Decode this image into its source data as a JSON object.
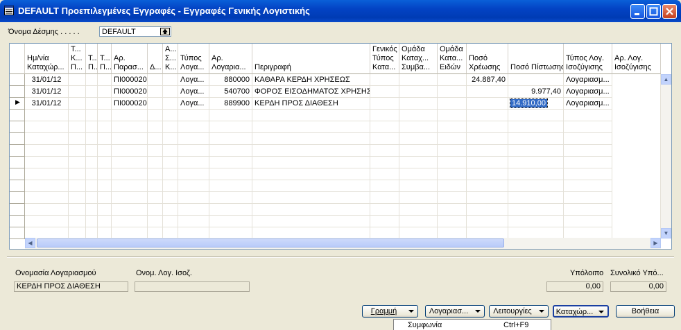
{
  "window": {
    "title": "DEFAULT Προεπιλεγμένες Εγγραφές - Εγγραφές Γενικής Λογιστικής"
  },
  "view": {
    "label": "Όνομα Δέσμης . . . . .",
    "value": "DEFAULT"
  },
  "grid": {
    "columns": [
      "Ημ/νία\nΚαταχώρ...",
      "Τ...\nΚ...\nΠ...",
      "Τ...\nΠ...",
      "Τ...\nΠ...",
      "Αρ.\nΠαρασ...",
      "Δ...",
      "Α...\nΣ...\nΚ...",
      "Τύπος\nΛογα...",
      "Αρ.\nΛογαρια...",
      "Περιγραφή",
      "Γενικός\nΤύπος\nΚατα...",
      "Ομάδα\nΚαταχ...\nΣυμβα...",
      "Ομάδα\nΚατα...\nΕιδών",
      "Ποσό\nΧρέωσης",
      "Ποσό Πίστωσης",
      "Τύπος Λογ.\nΙσοζύγισης",
      "Αρ. Λογ.\nΙσοζύγισης"
    ],
    "rows": [
      {
        "date": "31/01/12",
        "doc_no": "ΠΙ000020",
        "acc_type": "Λογα...",
        "acc_no": "880000",
        "description": "ΚΑΘΑΡΑ ΚΕΡΔΗ ΧΡΗΣΕΩΣ",
        "debit": "24.887,40",
        "credit": "",
        "bal_type": "Λογαριασμ..."
      },
      {
        "date": "31/01/12",
        "doc_no": "ΠΙ000020",
        "acc_type": "Λογα...",
        "acc_no": "540700",
        "description": "ΦΟΡΟΣ ΕΙΣΟΔΗΜΑΤΟΣ ΧΡΗΣΗΣ",
        "debit": "",
        "credit": "9.977,40",
        "bal_type": "Λογαριασμ..."
      },
      {
        "date": "31/01/12",
        "doc_no": "ΠΙ000020",
        "acc_type": "Λογα...",
        "acc_no": "889900",
        "description": "ΚΕΡΔΗ ΠΡΟΣ ΔΙΑΘΕΣΗ",
        "debit": "",
        "credit": "14.910,00",
        "bal_type": "Λογαριασμ..."
      }
    ],
    "current_row_marker": "▶"
  },
  "footer": {
    "account_name_label": "Ονομασία Λογαριασμού",
    "account_name_value": "ΚΕΡΔΗ ΠΡΟΣ ΔΙΑΘΕΣΗ",
    "bal_account_name_label": "Ονομ. Λογ. Ισοζ.",
    "bal_account_name_value": "",
    "balance_label": "Υπόλοιπο",
    "balance_value": "0,00",
    "total_balance_label": "Συνολικό Υπό...",
    "total_balance_value": "0,00"
  },
  "buttons": {
    "line": "Γραμμή",
    "account": "Λογαριασ...",
    "functions": "Λειτουργίες",
    "posting": "Καταχώρ...",
    "help": "Βοήθεια"
  },
  "popup_menu": {
    "item_label": "Συμφωνία",
    "item_shortcut": "Ctrl+F9"
  },
  "colors": {
    "titlebar": "#0343c4",
    "selection": "#316ac5",
    "face": "#ece9d8"
  }
}
